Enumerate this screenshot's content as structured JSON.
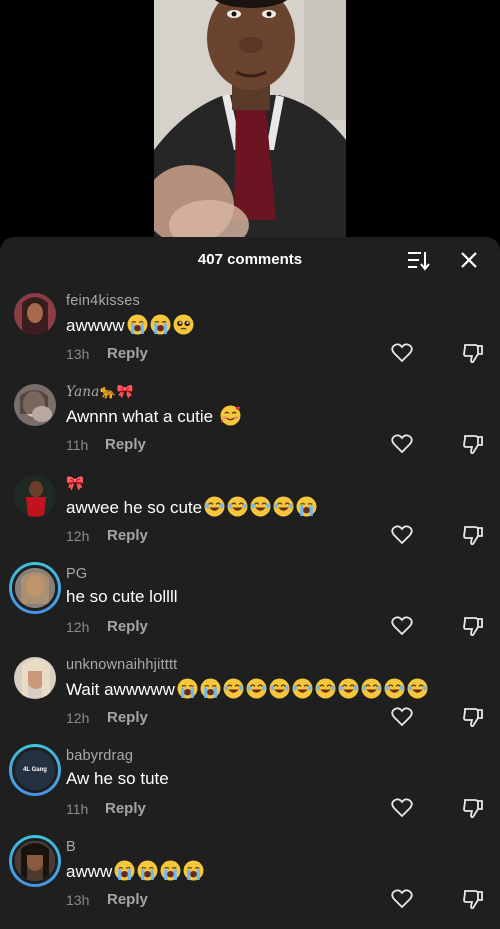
{
  "header": {
    "comments_count": "407 comments"
  },
  "colors": {
    "sheet_bg": "#1f1f1f",
    "story_ring": "#3ec6d9",
    "username": "#a9a9a9",
    "time": "#8a8a8a"
  },
  "comments": [
    {
      "username": "fein4kisses",
      "text": "awwww",
      "emojis": [
        "loudly-crying",
        "loudly-crying",
        "pleading"
      ],
      "time": "13h",
      "reply": "Reply"
    },
    {
      "username": "Yana",
      "username_decor": "🐆🎀",
      "text": "Awnnn what a cutie ",
      "emojis": [
        "smiling-hearts"
      ],
      "time": "11h",
      "reply": "Reply"
    },
    {
      "username": "🎀",
      "text": "awwee he so cute",
      "emojis": [
        "laughing",
        "laughing",
        "laughing",
        "laughing",
        "loudly-crying"
      ],
      "time": "12h",
      "reply": "Reply"
    },
    {
      "username": "PG",
      "text": "he so cute lollll",
      "emojis": [],
      "time": "12h",
      "reply": "Reply"
    },
    {
      "username": "unknownaihhjitttt",
      "text": "Wait awwwww",
      "emojis": [
        "loudly-crying",
        "loudly-crying",
        "laughing",
        "laughing",
        "laughing",
        "laughing",
        "laughing",
        "laughing",
        "laughing",
        "laughing",
        "laughing"
      ],
      "time": "12h",
      "reply": "Reply"
    },
    {
      "username": "babyrdrag",
      "avatar_text": "4L Gang",
      "text": "Aw he so tute",
      "emojis": [],
      "time": "11h",
      "reply": "Reply"
    },
    {
      "username": "B",
      "text": "awww",
      "emojis": [
        "loudly-crying",
        "loudly-crying",
        "loudly-crying",
        "loudly-crying"
      ],
      "time": "13h",
      "reply": "Reply"
    }
  ]
}
